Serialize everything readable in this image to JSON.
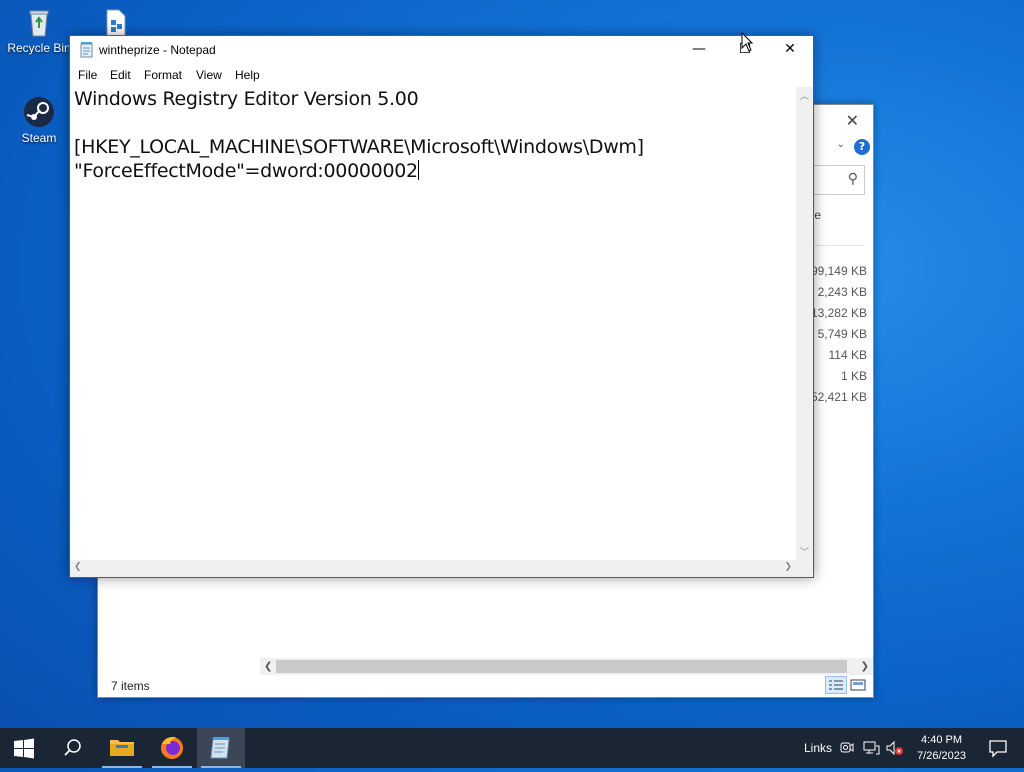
{
  "desktop": {
    "icons": [
      {
        "label": "Recycle Bin"
      },
      {
        "label": "Steam"
      }
    ]
  },
  "explorer": {
    "file_sizes": [
      "599,149 KB",
      "2,243 KB",
      "13,282 KB",
      "5,749 KB",
      "114 KB",
      "1 KB",
      "52,421 KB"
    ],
    "column_partial": "e",
    "status": "7 items"
  },
  "notepad": {
    "title": "wintheprize - Notepad",
    "menu": [
      "File",
      "Edit",
      "Format",
      "View",
      "Help"
    ],
    "lines": [
      "Windows Registry Editor Version 5.00",
      "",
      "[HKEY_LOCAL_MACHINE\\SOFTWARE\\Microsoft\\Windows\\Dwm]",
      "\"ForceEffectMode\"=dword:00000002"
    ]
  },
  "taskbar": {
    "links_label": "Links",
    "time": "4:40 PM",
    "date": "7/26/2023"
  },
  "colors": {
    "taskbar_bg": "#1b2635",
    "accent": "#1f6fd1"
  }
}
